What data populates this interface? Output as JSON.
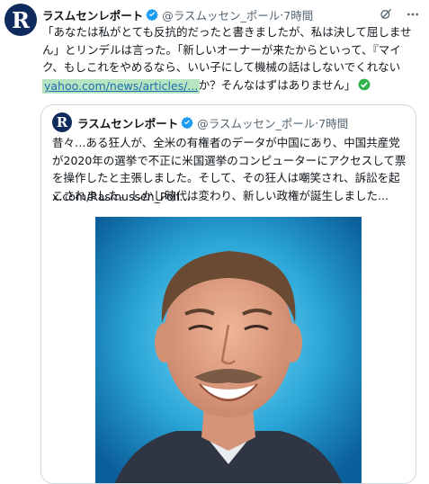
{
  "colors": {
    "avatar_bg": "#0f2a5c",
    "verified": "#1d9bf0",
    "link": "#1d6db0",
    "link_highlight": "#b8e5c1",
    "muted": "#536471"
  },
  "tweet": {
    "author_name": "ラスムセンレポート",
    "avatar_letter": "R",
    "handle": "@ラスムッセン_ポール",
    "separator": "·",
    "time": "7時間",
    "icons": [
      "grok-icon",
      "more-icon"
    ],
    "text": "「あなたは私がとても反抗的だったと書きましたが、私は決して屈しません」とリンデルは言った。「新しいオーナーが来たからといって、『マイク、もしこれをやめるなら、いい子にして機械の話はしないでくれないか？』なんて言われるでしょうか？そんなはずはありません」",
    "link": "yahoo.com/news/articles/..."
  },
  "quote": {
    "author_name": "ラスムセンレポート",
    "avatar_letter": "R",
    "handle": "@ラスムッセン_ポール",
    "separator": "·",
    "time": "7時間",
    "text": "昔々…ある狂人が、全米の有権者のデータが中国にあり、中国共産党が2020年の選挙で不正に米国選挙のコンピューターにアクセスして票を操作したと主張しました。そして、その狂人は嘲笑され、訴訟を起こされました。しかし時代は変わり、新しい政権が誕生しました...",
    "url": "x.com/Rasmussen_Poll..."
  }
}
